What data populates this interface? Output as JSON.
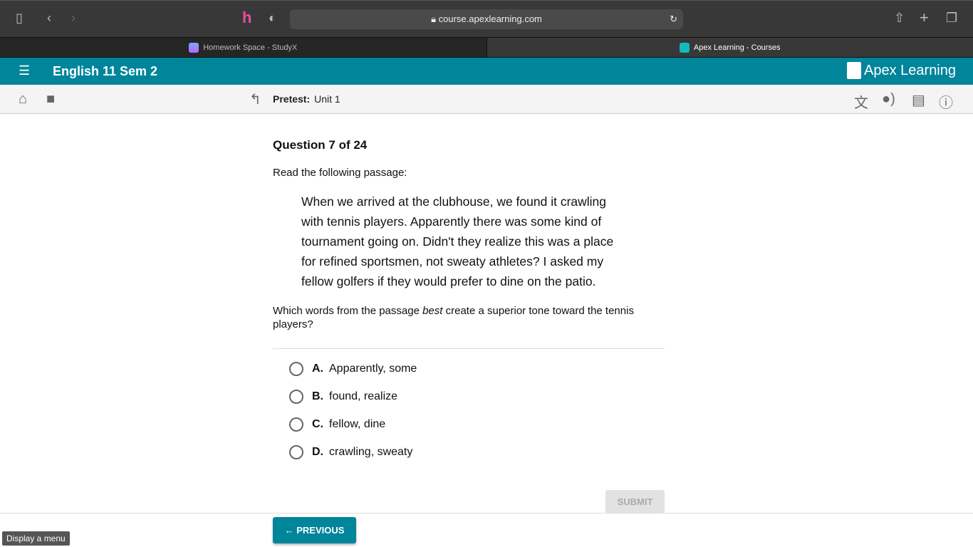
{
  "browser": {
    "url": "course.apexlearning.com",
    "tabs": [
      {
        "label": "Homework Space - StudyX",
        "active": false
      },
      {
        "label": "Apex Learning - Courses",
        "active": true
      }
    ]
  },
  "appbar": {
    "course_title": "English 11 Sem 2",
    "logo": "Apex Learning",
    "accent": "#00859b"
  },
  "toolbar": {
    "crumb_label": "Pretest:",
    "crumb_value": "Unit 1"
  },
  "question": {
    "number": "Question 7 of 24",
    "intro": "Read the following passage:",
    "passage": "When we arrived at the clubhouse, we found it crawling with tennis players. Apparently there was some kind of tournament going on. Didn't they realize this was a place for refined sportsmen, not sweaty athletes? I asked my fellow golfers if they would prefer to dine on the patio.",
    "stem_before": "Which words from the passage ",
    "stem_em": "best",
    "stem_after": " create a superior tone toward the tennis players?",
    "options": [
      {
        "letter": "A.",
        "text": "Apparently, some"
      },
      {
        "letter": "B.",
        "text": "found, realize"
      },
      {
        "letter": "C.",
        "text": "fellow, dine"
      },
      {
        "letter": "D.",
        "text": "crawling, sweaty"
      }
    ]
  },
  "actions": {
    "submit": "SUBMIT",
    "previous": "PREVIOUS"
  },
  "tooltip": "Display a menu"
}
